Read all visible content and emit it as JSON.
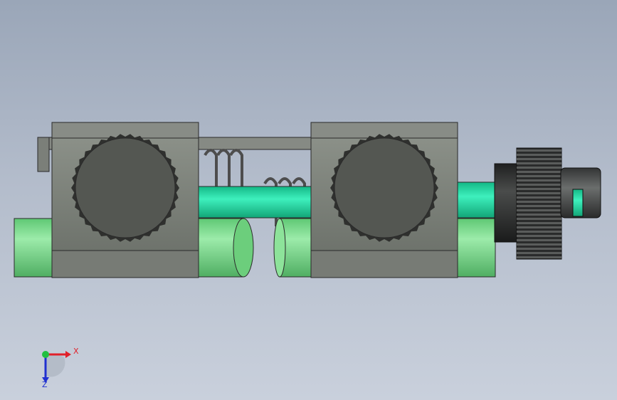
{
  "viewport": {
    "background_top": "#9aa6b8",
    "background_bottom": "#c9d0dc"
  },
  "model": {
    "body_color": "#7d827a",
    "knob_color": "#545752",
    "rod_color": "#22e0a8",
    "cylinder_color": "#7fdc8c",
    "spring_color": "#5b5b5b",
    "thumbscrew_color": "#2e2f2f"
  },
  "triad": {
    "x_label": "X",
    "z_label": "Z",
    "x_color": "#e0202a",
    "y_color": "#22c040",
    "z_color": "#2030d0"
  }
}
